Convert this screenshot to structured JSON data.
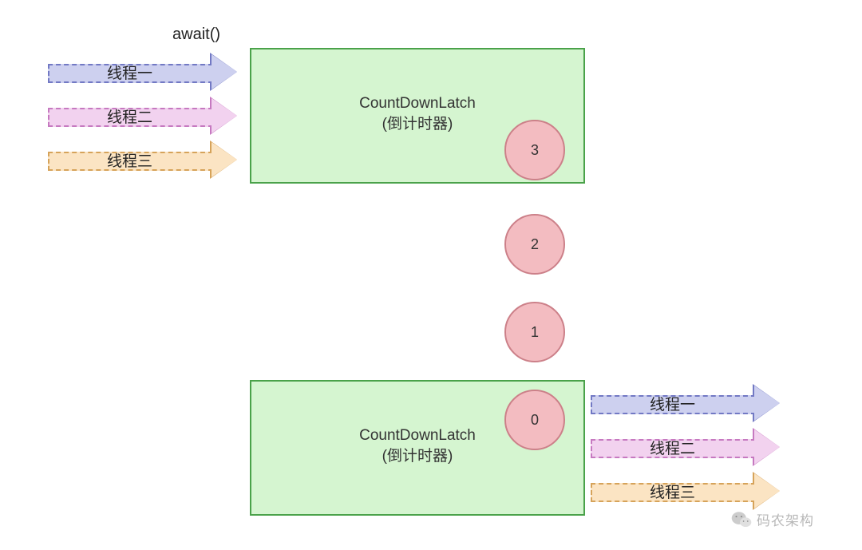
{
  "await_label": "await()",
  "threads_in": [
    "线程一",
    "线程二",
    "线程三"
  ],
  "threads_out": [
    "线程一",
    "线程二",
    "线程三"
  ],
  "box_top": {
    "line1": "CountDownLatch",
    "line2": "(倒计时器)"
  },
  "box_bottom": {
    "line1": "CountDownLatch",
    "line2": "(倒计时器)"
  },
  "counters": {
    "c3": "3",
    "c2": "2",
    "c1": "1",
    "c0": "0"
  },
  "watermark": "码农架构",
  "colors": {
    "box_fill": "#d5f5d0",
    "box_border": "#4aa24a",
    "circle_fill": "#f3bcc1",
    "circle_border": "#cc8089",
    "arrow_blue": "#cdd0ef",
    "arrow_pink": "#f2d2ef",
    "arrow_tan": "#fbe4c3"
  }
}
